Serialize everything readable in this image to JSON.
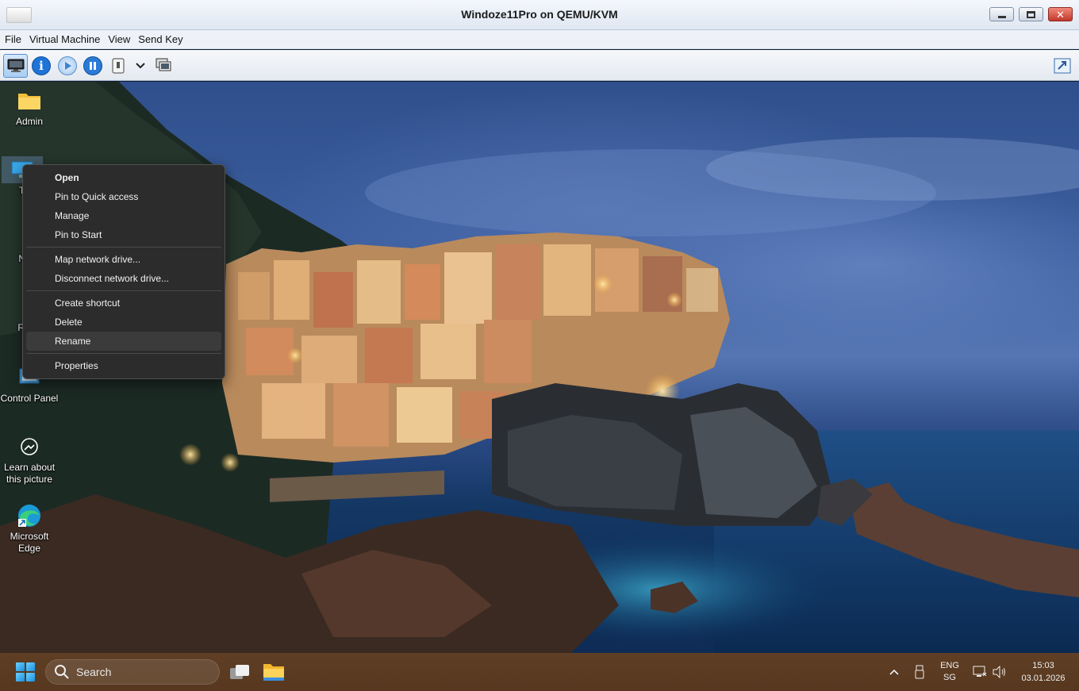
{
  "window": {
    "title": "Windoze11Pro on QEMU/KVM",
    "controls": [
      "minimize",
      "maximize",
      "close"
    ]
  },
  "menubar": {
    "items": [
      {
        "label": "File"
      },
      {
        "label": "Virtual Machine"
      },
      {
        "label": "View"
      },
      {
        "label": "Send Key"
      }
    ]
  },
  "toolbar": {
    "buttons": [
      {
        "icon": "console-monitor-icon",
        "active": true
      },
      {
        "icon": "info-icon"
      },
      {
        "icon": "run-icon"
      },
      {
        "icon": "pause-icon"
      },
      {
        "icon": "shutdown-icon"
      },
      {
        "icon": "chevron-down-icon"
      },
      {
        "icon": "snapshot-icon"
      },
      {
        "icon": "fullscreen-icon"
      }
    ]
  },
  "desktop": {
    "icons": [
      {
        "label": "Admin",
        "icon": "folder-icon"
      },
      {
        "label": "Th",
        "icon": "this-pc-icon"
      },
      {
        "label": "Ne",
        "icon": "network-icon"
      },
      {
        "label": "Rec",
        "icon": "recycle-bin-icon"
      },
      {
        "label": "Control Panel",
        "icon": "control-panel-icon"
      },
      {
        "label": "Learn about this picture",
        "icon": "learn-picture-icon"
      },
      {
        "label": "Microsoft Edge",
        "icon": "edge-icon"
      }
    ],
    "context_menu": {
      "groups": [
        [
          "Open",
          "Pin to Quick access",
          "Manage",
          "Pin to Start"
        ],
        [
          "Map network drive...",
          "Disconnect network drive..."
        ],
        [
          "Create shortcut",
          "Delete",
          "Rename"
        ],
        [
          "Properties"
        ]
      ],
      "default_item": "Open",
      "hovered_item": "Rename"
    }
  },
  "taskbar": {
    "search_placeholder": "Search",
    "pinned": [
      "start-icon",
      "task-view-icon",
      "file-explorer-icon"
    ],
    "tray": {
      "lang_line1": "ENG",
      "lang_line2": "SG",
      "time": "15:03",
      "date": "03.01.2026"
    },
    "colors": {
      "taskbar": "#5a3a22",
      "menu_bg": "#2c2c2c"
    }
  }
}
